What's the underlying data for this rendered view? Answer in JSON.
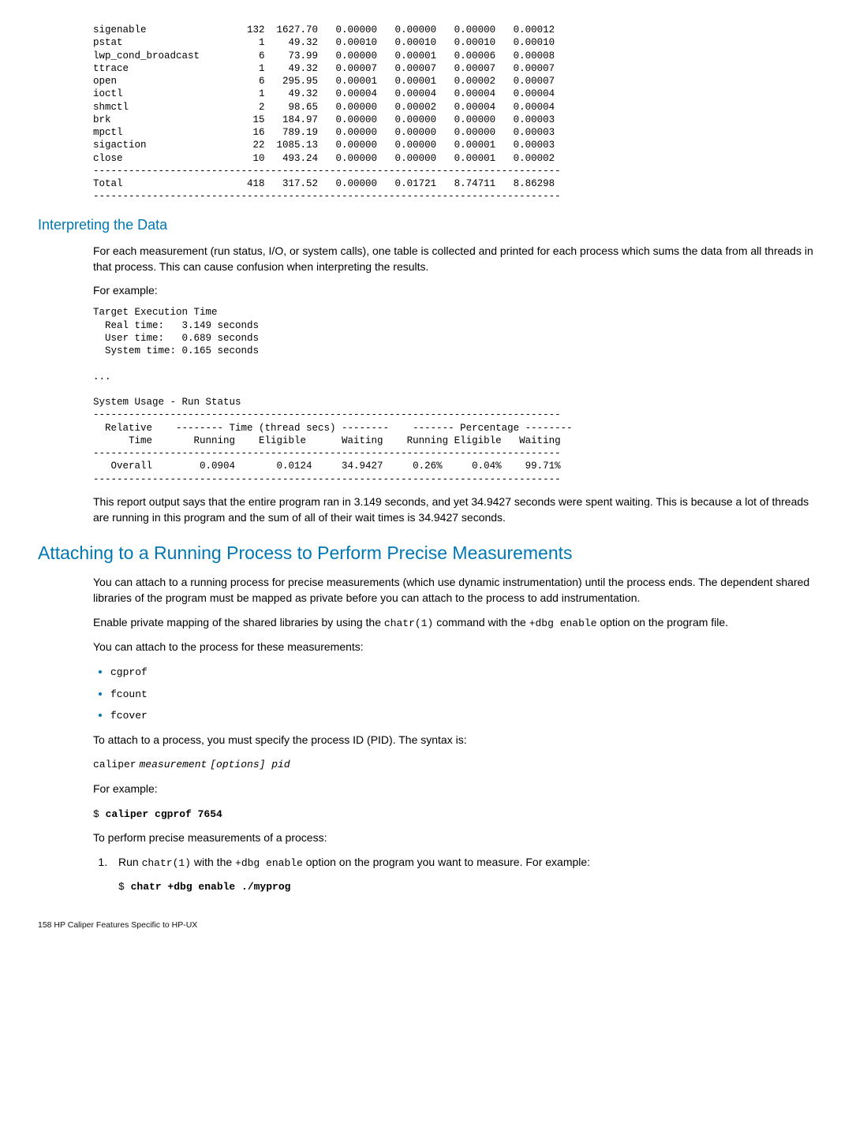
{
  "syscall_table": {
    "rows": [
      {
        "name": "sigenable",
        "count": 132,
        "time": "1627.70",
        "avg": "0.00000",
        "min": "0.00000",
        "max": "0.00000",
        "cum": "0.00012"
      },
      {
        "name": "pstat",
        "count": 1,
        "time": "49.32",
        "avg": "0.00010",
        "min": "0.00010",
        "max": "0.00010",
        "cum": "0.00010"
      },
      {
        "name": "lwp_cond_broadcast",
        "count": 6,
        "time": "73.99",
        "avg": "0.00000",
        "min": "0.00001",
        "max": "0.00006",
        "cum": "0.00008"
      },
      {
        "name": "ttrace",
        "count": 1,
        "time": "49.32",
        "avg": "0.00007",
        "min": "0.00007",
        "max": "0.00007",
        "cum": "0.00007"
      },
      {
        "name": "open",
        "count": 6,
        "time": "295.95",
        "avg": "0.00001",
        "min": "0.00001",
        "max": "0.00002",
        "cum": "0.00007"
      },
      {
        "name": "ioctl",
        "count": 1,
        "time": "49.32",
        "avg": "0.00004",
        "min": "0.00004",
        "max": "0.00004",
        "cum": "0.00004"
      },
      {
        "name": "shmctl",
        "count": 2,
        "time": "98.65",
        "avg": "0.00000",
        "min": "0.00002",
        "max": "0.00004",
        "cum": "0.00004"
      },
      {
        "name": "brk",
        "count": 15,
        "time": "184.97",
        "avg": "0.00000",
        "min": "0.00000",
        "max": "0.00000",
        "cum": "0.00003"
      },
      {
        "name": "mpctl",
        "count": 16,
        "time": "789.19",
        "avg": "0.00000",
        "min": "0.00000",
        "max": "0.00000",
        "cum": "0.00003"
      },
      {
        "name": "sigaction",
        "count": 22,
        "time": "1085.13",
        "avg": "0.00000",
        "min": "0.00000",
        "max": "0.00001",
        "cum": "0.00003"
      },
      {
        "name": "close",
        "count": 10,
        "time": "493.24",
        "avg": "0.00000",
        "min": "0.00000",
        "max": "0.00001",
        "cum": "0.00002"
      }
    ],
    "total": {
      "name": "Total",
      "count": 418,
      "time": "317.52",
      "avg": "0.00000",
      "min": "0.01721",
      "max": "8.74711",
      "cum": "8.86298"
    }
  },
  "subsection1": {
    "heading": "Interpreting the Data",
    "para1": "For each measurement (run status, I/O, or system calls), one table is collected and printed for each process which sums the data from all threads in that process. This can cause confusion when interpreting the results.",
    "for_example": "For example:",
    "exec_block": "Target Execution Time\n  Real time:   3.149 seconds\n  User time:   0.689 seconds\n  System time: 0.165 seconds\n\n...\n\nSystem Usage - Run Status",
    "runstatus_header1": "  Relative    -------- Time (thread secs) --------    ------- Percentage --------",
    "runstatus_header2": "      Time       Running    Eligible      Waiting    Running Eligible   Waiting",
    "runstatus_row": "   Overall        0.0904       0.0124     34.9427     0.26%     0.04%    99.71%",
    "para2": "This report output says that the entire program ran in 3.149 seconds, and yet 34.9427 seconds were spent waiting. This is because a lot of threads are running in this program and the sum of all of their wait times is 34.9427 seconds."
  },
  "section2": {
    "heading": "Attaching to a Running Process to Perform Precise Measurements",
    "para1": "You can attach to a running process for precise measurements (which use dynamic instrumentation) until the process ends. The dependent shared libraries of the program must be mapped as private before you can attach to the process to add instrumentation.",
    "para2_pre": "Enable private mapping of the shared libraries by using the ",
    "para2_code1": "chatr(1)",
    "para2_mid": " command with the ",
    "para2_code2": "+dbg enable",
    "para2_post": " option on the program file.",
    "para3": "You can attach to the process for these measurements:",
    "bullets": [
      "cgprof",
      "fcount",
      "fcover"
    ],
    "attach_intro": "To attach to a process, you must specify the process ID (PID). The syntax is:",
    "syntax_cmd": "caliper",
    "syntax_meas": "measurement",
    "syntax_opts": "[options] pid",
    "for_example": "For example:",
    "example_cmd_prefix": "$ ",
    "example_cmd": "caliper cgprof 7654",
    "precise_intro": "To perform precise measurements of a process:",
    "step1_pre": "Run ",
    "step1_code1": "chatr(1)",
    "step1_mid": " with the ",
    "step1_code2": "+dbg enable",
    "step1_post": " option on the program you want to measure. For example:",
    "step1_cmd_prefix": "$ ",
    "step1_cmd": "chatr +dbg enable ./myprog"
  },
  "footer": "158   HP Caliper Features Specific to HP-UX"
}
